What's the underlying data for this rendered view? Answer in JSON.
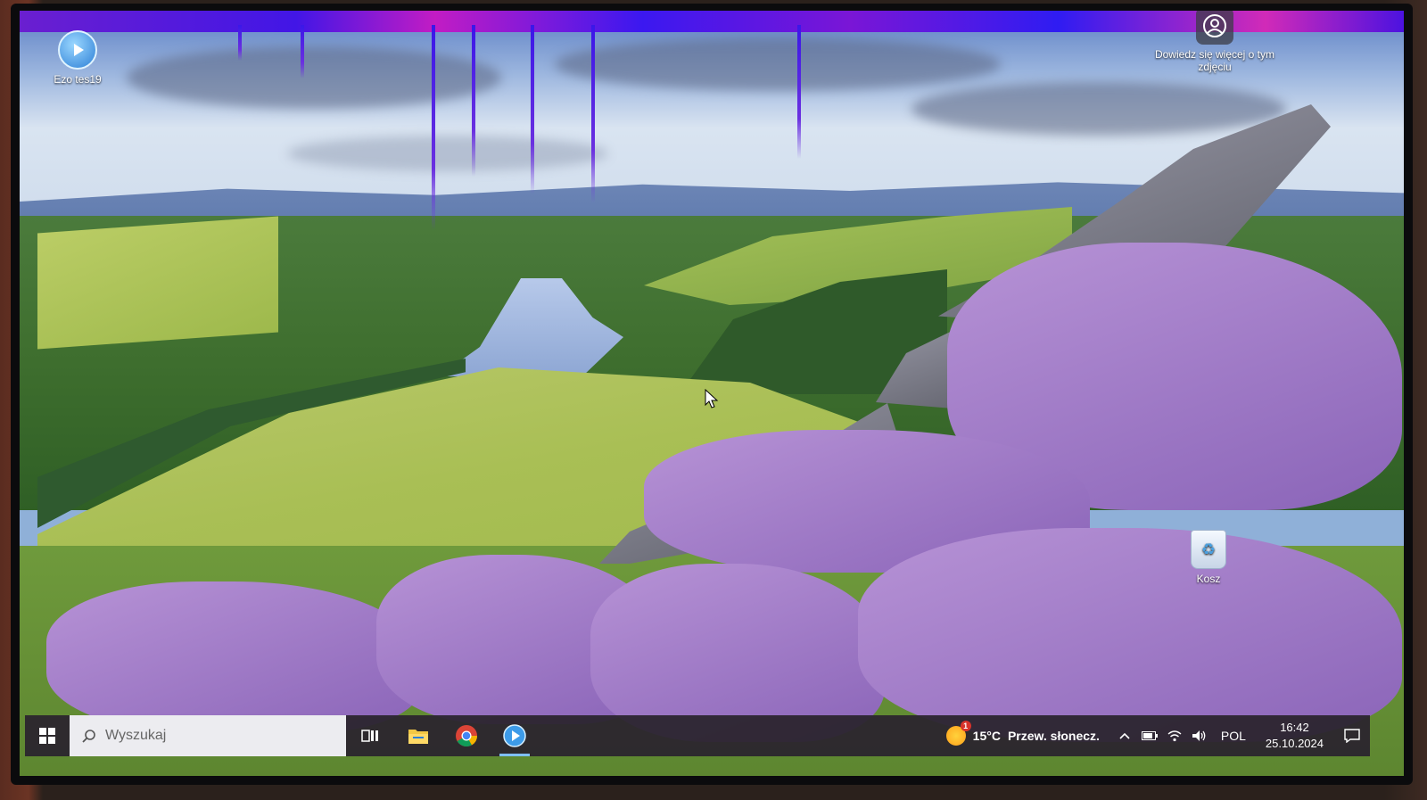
{
  "desktop": {
    "icons": [
      {
        "label": "Ezo tes19"
      },
      {
        "label": "Dowiedz się więcej o tym zdjęciu"
      },
      {
        "label": "Kosz"
      }
    ]
  },
  "taskbar": {
    "search_placeholder": "Wyszukaj",
    "weather": {
      "temp": "15°C",
      "desc": "Przew. słonecz.",
      "badge": "1"
    },
    "language": "POL",
    "time": "16:42",
    "date": "25.10.2024"
  },
  "colors": {
    "taskbar_bg": "#2a242e",
    "search_bg": "#ececf0",
    "active_indicator": "#7fbfff",
    "glitch": "#3b18f0"
  }
}
